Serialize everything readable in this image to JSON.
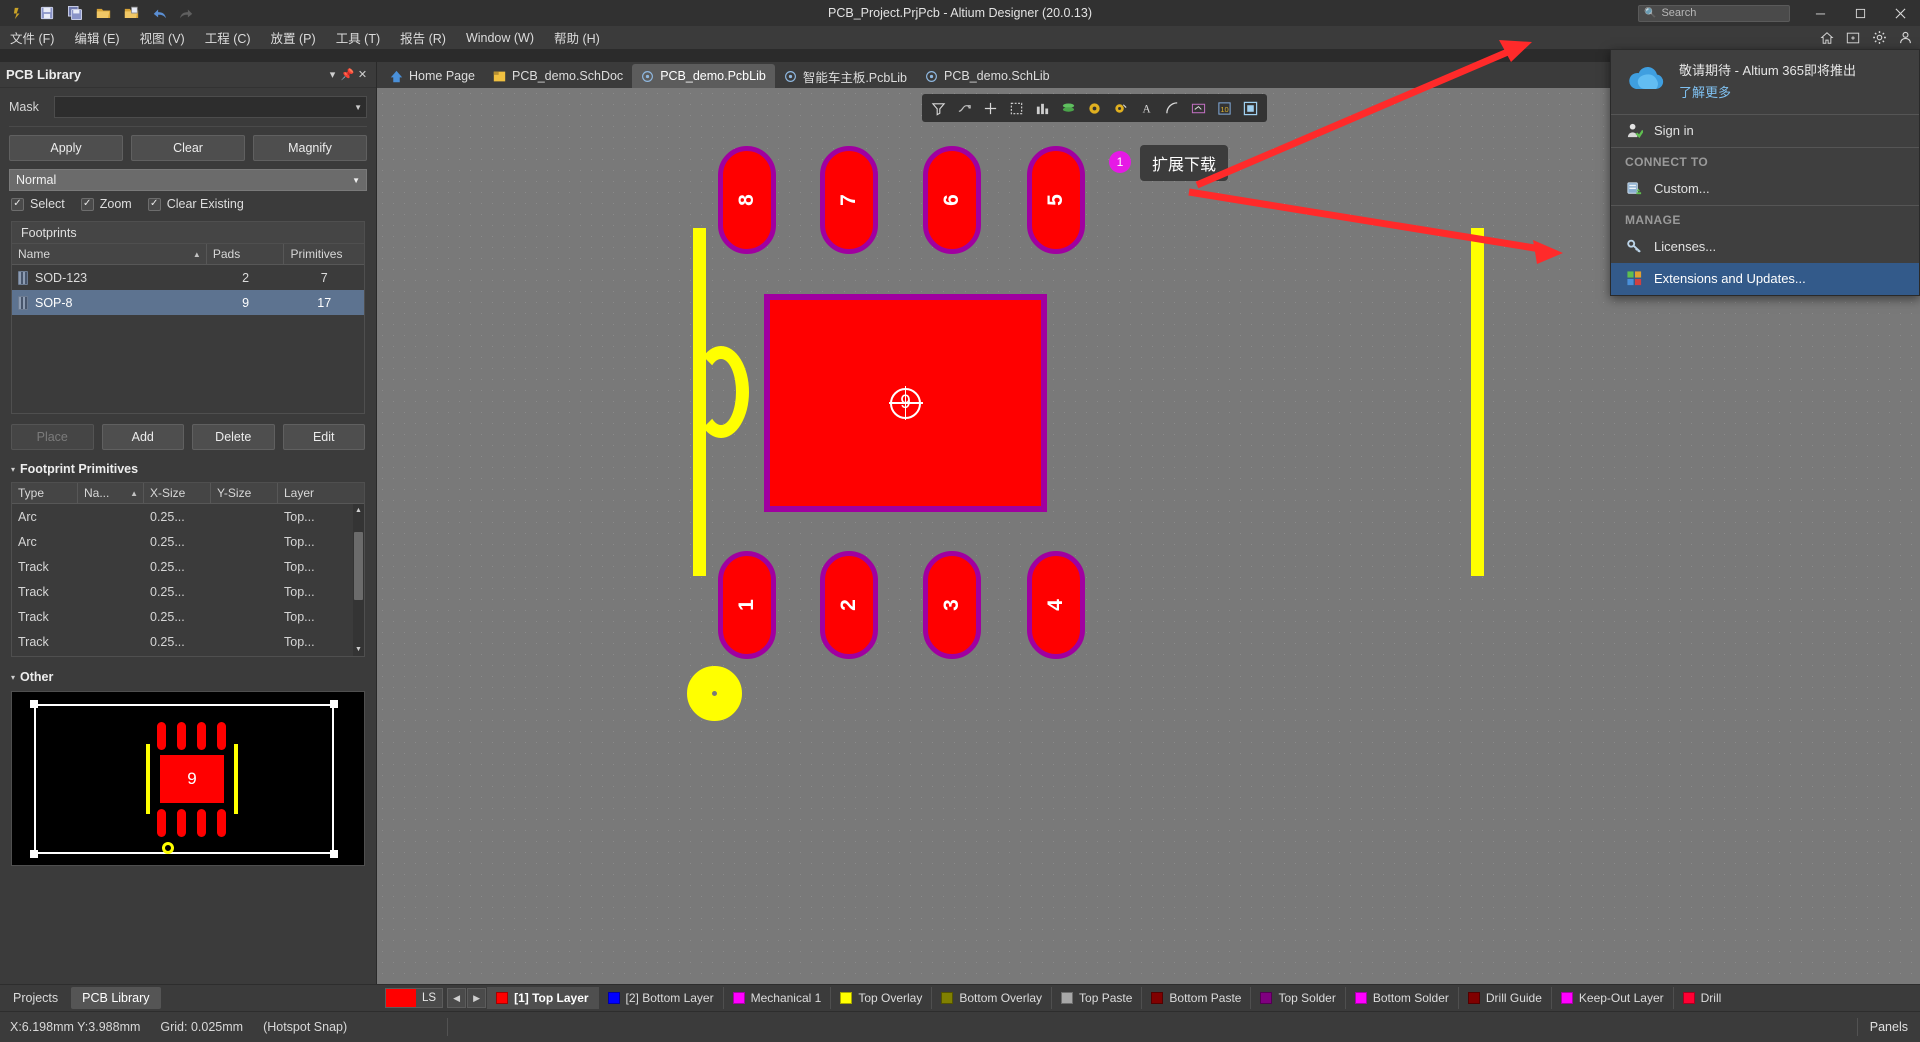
{
  "window": {
    "title": "PCB_Project.PrjPcb - Altium Designer (20.0.13)",
    "toolbar_icons": [
      "altium-logo-icon",
      "save-icon",
      "save-all-icon",
      "open-folder-icon",
      "open-project-icon",
      "undo-icon",
      "redo-icon"
    ],
    "search_placeholder": "Search",
    "search_icon": "magnifier-icon",
    "minimize": "minimize-icon",
    "maximize": "maximize-icon",
    "close": "close-icon"
  },
  "menubar": {
    "items": [
      {
        "label": "文件 (F)"
      },
      {
        "label": "编辑 (E)"
      },
      {
        "label": "视图 (V)"
      },
      {
        "label": "工程 (C)"
      },
      {
        "label": "放置 (P)"
      },
      {
        "label": "工具 (T)"
      },
      {
        "label": "报告 (R)"
      },
      {
        "label": "Window (W)"
      },
      {
        "label": "帮助 (H)"
      }
    ],
    "right_icons": [
      "home-icon",
      "add-panel-icon",
      "settings-gear-icon",
      "user-account-icon"
    ]
  },
  "panel": {
    "title": "PCB Library",
    "header_controls": [
      "chevron-down-icon",
      "pin-icon",
      "close-icon"
    ],
    "mask": {
      "label": "Mask",
      "value": "",
      "placeholder": ""
    },
    "buttons": {
      "apply": "Apply",
      "clear": "Clear",
      "magnify": "Magnify"
    },
    "mode": {
      "value": "Normal"
    },
    "checkboxes": [
      {
        "label": "Select",
        "checked": true
      },
      {
        "label": "Zoom",
        "checked": true
      },
      {
        "label": "Clear Existing",
        "checked": true
      }
    ],
    "footprints": {
      "section_label": "Footprints",
      "columns": [
        "Name",
        "Pads",
        "Primitives"
      ],
      "sort_column": "Name",
      "rows": [
        {
          "name": "SOD-123",
          "pads": "2",
          "primitives": "7",
          "selected": false
        },
        {
          "name": "SOP-8",
          "pads": "9",
          "primitives": "17",
          "selected": true
        }
      ]
    },
    "footprint_buttons": {
      "place": "Place",
      "place_disabled": true,
      "add": "Add",
      "delete": "Delete",
      "edit": "Edit"
    },
    "primitives": {
      "section_label": "Footprint Primitives",
      "columns": [
        "Type",
        "Na...",
        "X-Size",
        "Y-Size",
        "Layer"
      ],
      "sort_column": "Na...",
      "rows": [
        {
          "type": "Arc",
          "name": "",
          "xsize": "0.25...",
          "ysize": "",
          "layer": "Top..."
        },
        {
          "type": "Arc",
          "name": "",
          "xsize": "0.25...",
          "ysize": "",
          "layer": "Top..."
        },
        {
          "type": "Track",
          "name": "",
          "xsize": "0.25...",
          "ysize": "",
          "layer": "Top..."
        },
        {
          "type": "Track",
          "name": "",
          "xsize": "0.25...",
          "ysize": "",
          "layer": "Top..."
        },
        {
          "type": "Track",
          "name": "",
          "xsize": "0.25...",
          "ysize": "",
          "layer": "Top..."
        },
        {
          "type": "Track",
          "name": "",
          "xsize": "0.25...",
          "ysize": "",
          "layer": "Top..."
        }
      ]
    },
    "other": {
      "section_label": "Other",
      "preview_pad_label": "9"
    },
    "bottom_tabs": [
      {
        "label": "Projects",
        "active": false
      },
      {
        "label": "PCB Library",
        "active": true
      }
    ]
  },
  "doctabs": [
    {
      "label": "Home Page",
      "icon": "altium-home-icon",
      "active": false
    },
    {
      "label": "PCB_demo.SchDoc",
      "icon": "schdoc-icon",
      "active": false
    },
    {
      "label": "PCB_demo.PcbLib",
      "icon": "pcblib-icon",
      "active": true
    },
    {
      "label": "智能车主板.PcbLib",
      "icon": "pcblib-icon",
      "active": false
    },
    {
      "label": "PCB_demo.SchLib",
      "icon": "schlib-icon",
      "active": false
    }
  ],
  "canvas_toolbar": [
    "filter-icon",
    "measure-icon",
    "crosshair-icon",
    "select-area-icon",
    "align-icon",
    "layer-stack-icon",
    "hole-size-icon",
    "pad-via-icon",
    "text-icon",
    "arc-icon",
    "dimension-icon",
    "chart-icon",
    "fit-board-icon"
  ],
  "footprint_view": {
    "pads_top": [
      "8",
      "7",
      "6",
      "5"
    ],
    "pads_bottom": [
      "1",
      "2",
      "3",
      "4"
    ],
    "thermal_pad": "9"
  },
  "annotation": {
    "badge": "1",
    "callout_text": "扩展下载",
    "arrow_color": "#ff2a2a",
    "badge_color": "#e619e6"
  },
  "account_dropdown": {
    "banner_title": "敬请期待 - Altium 365即将推出",
    "banner_link": "了解更多",
    "banner_icon": "cloud-icon",
    "signin": {
      "label": "Sign in",
      "icon": "sign-in-icon"
    },
    "connect_group": "CONNECT TO",
    "connect_items": [
      {
        "label": "Custom...",
        "icon": "server-icon"
      }
    ],
    "manage_group": "MANAGE",
    "manage_items": [
      {
        "label": "Licenses...",
        "icon": "key-icon",
        "highlighted": false
      },
      {
        "label": "Extensions and Updates...",
        "icon": "extensions-icon",
        "highlighted": true
      }
    ]
  },
  "layerbar": {
    "ls_label": "LS",
    "ls_color": "#ff0000",
    "prev_icon": "chevron-left-icon",
    "next_icon": "chevron-right-icon",
    "layers": [
      {
        "label": "[1] Top Layer",
        "color": "#ff0000",
        "active": true
      },
      {
        "label": "[2] Bottom Layer",
        "color": "#0000ff",
        "active": false
      },
      {
        "label": "Mechanical 1",
        "color": "#ff00ff",
        "active": false
      },
      {
        "label": "Top Overlay",
        "color": "#ffff00",
        "active": false
      },
      {
        "label": "Bottom Overlay",
        "color": "#808000",
        "active": false
      },
      {
        "label": "Top Paste",
        "color": "#a8a8a8",
        "active": false
      },
      {
        "label": "Bottom Paste",
        "color": "#800000",
        "active": false
      },
      {
        "label": "Top Solder",
        "color": "#800080",
        "active": false
      },
      {
        "label": "Bottom Solder",
        "color": "#ff00ff",
        "active": false
      },
      {
        "label": "Drill Guide",
        "color": "#800000",
        "active": false
      },
      {
        "label": "Keep-Out Layer",
        "color": "#ff00ff",
        "active": false
      },
      {
        "label": "Drill",
        "color": "#ff0033",
        "active": false
      }
    ]
  },
  "statusbar": {
    "coords": "X:6.198mm Y:3.988mm",
    "grid": "Grid: 0.025mm",
    "snap": "(Hotspot Snap)",
    "panels": "Panels"
  }
}
